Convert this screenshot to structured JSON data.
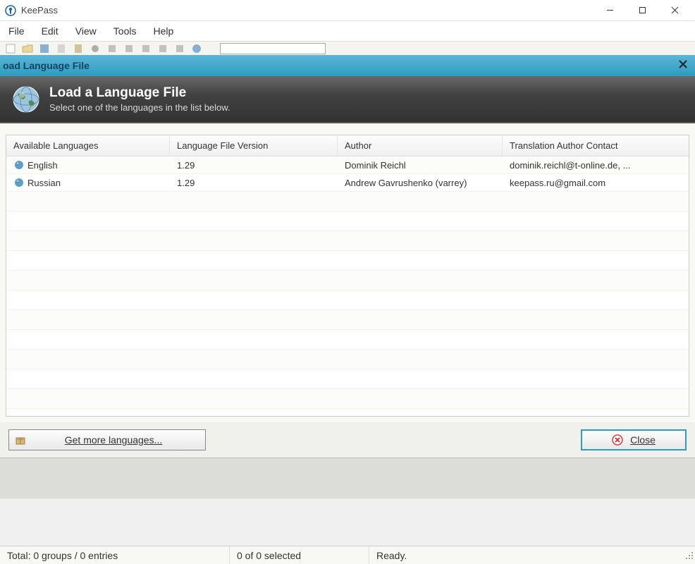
{
  "app": {
    "title": "KeePass"
  },
  "menu": {
    "file": "File",
    "edit": "Edit",
    "view": "View",
    "tools": "Tools",
    "help": "Help"
  },
  "dialog": {
    "titlebar_text": "oad Language File",
    "header_title": "Load a Language File",
    "header_subtitle": "Select one of the languages in the list below.",
    "columns": {
      "language": "Available Languages",
      "version": "Language File Version",
      "author": "Author",
      "contact": "Translation Author Contact"
    },
    "rows": [
      {
        "language": "English",
        "version": "1.29",
        "author": "Dominik Reichl",
        "contact": "dominik.reichl@t-online.de, ..."
      },
      {
        "language": "Russian",
        "version": "1.29",
        "author": "Andrew Gavrushenko (varrey)",
        "contact": "keepass.ru@gmail.com"
      }
    ],
    "get_more_label": "Get more languages...",
    "close_label": "Close"
  },
  "status": {
    "total": "Total: 0 groups / 0 entries",
    "selected": "0 of 0 selected",
    "ready": "Ready."
  }
}
